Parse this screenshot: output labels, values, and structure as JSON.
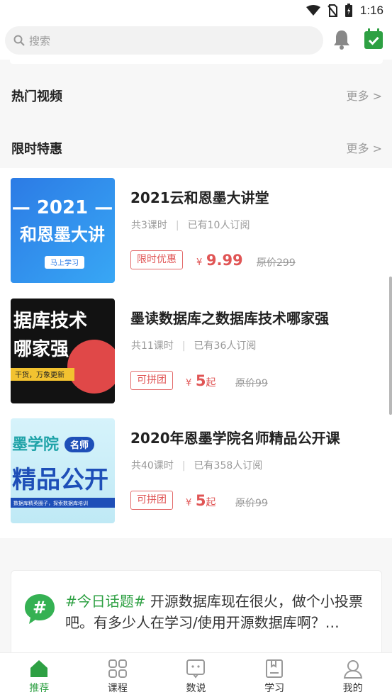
{
  "status": {
    "time": "1:16"
  },
  "search": {
    "placeholder": "搜索"
  },
  "sections": {
    "hot_videos": {
      "title": "热门视频",
      "more": "更多 >"
    },
    "limited_offer": {
      "title": "限时特惠",
      "more": "更多 >"
    }
  },
  "courses": [
    {
      "title": "2021云和恩墨大讲堂",
      "lessons": "共3课时",
      "subscribers": "已有10人订阅",
      "tag": "限时优惠",
      "price_symbol": "¥",
      "price": "9.99",
      "price_suffix": "",
      "original_price": "原价299",
      "thumb_text": [
        "— 2021 —",
        "和恩墨大讲",
        "马上学习"
      ]
    },
    {
      "title": "墨读数据库之数据库技术哪家强",
      "lessons": "共11课时",
      "subscribers": "已有36人订阅",
      "tag": "可拼团",
      "price_symbol": "¥",
      "price": "5",
      "price_suffix": "起",
      "original_price": "原价99",
      "thumb_text": [
        "据库技术",
        "哪家强",
        "干货，万象更新"
      ]
    },
    {
      "title": "2020年恩墨学院名师精品公开课",
      "lessons": "共40课时",
      "subscribers": "已有358人订阅",
      "tag": "可拼团",
      "price_symbol": "¥",
      "price": "5",
      "price_suffix": "起",
      "original_price": "原价99",
      "thumb_text": [
        "墨学院",
        "名师",
        "精品公开",
        "数据库精英圈子，探索数据库培训"
      ]
    }
  ],
  "topic": {
    "tag": "#今日话题#",
    "text": " 开源数据库现在很火，做个小投票吧。有多少人在学习/使用开源数据库啊？…"
  },
  "tabs": [
    {
      "label": "推荐",
      "icon": "home-icon",
      "active": true
    },
    {
      "label": "课程",
      "icon": "grid-icon",
      "active": false
    },
    {
      "label": "数说",
      "icon": "chat-icon",
      "active": false
    },
    {
      "label": "学习",
      "icon": "book-icon",
      "active": false
    },
    {
      "label": "我的",
      "icon": "user-icon",
      "active": false
    }
  ],
  "colors": {
    "accent": "#2ea043",
    "price": "#e05555"
  }
}
